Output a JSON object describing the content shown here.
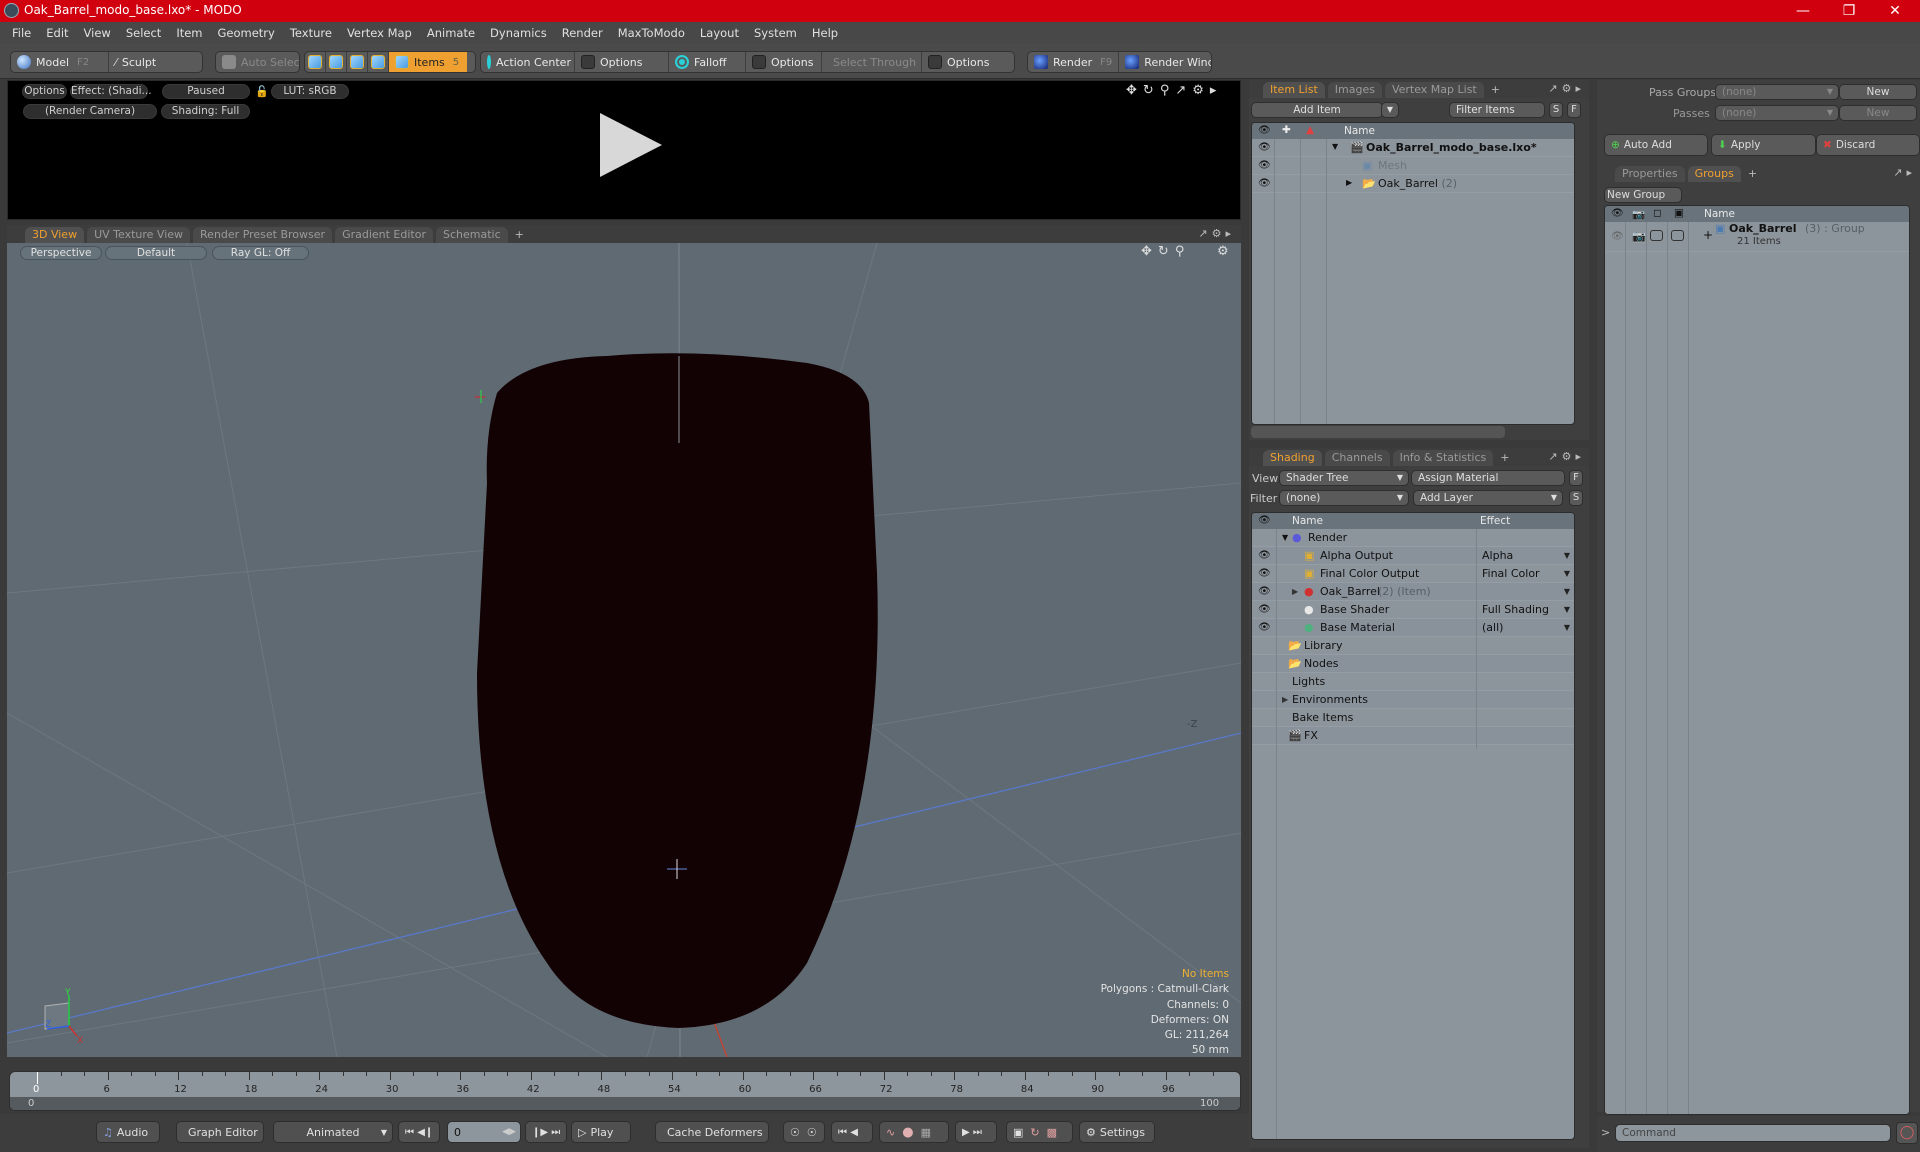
{
  "window": {
    "title": "Oak_Barrel_modo_base.lxo* - MODO",
    "controls": [
      "minimize",
      "restore",
      "close"
    ]
  },
  "menu": [
    "File",
    "Edit",
    "View",
    "Select",
    "Item",
    "Geometry",
    "Texture",
    "Vertex Map",
    "Animate",
    "Dynamics",
    "Render",
    "MaxToModo",
    "Layout",
    "System",
    "Help"
  ],
  "toolbar": {
    "model": "Model",
    "model_key": "F2",
    "sculpt": "Sculpt",
    "auto_select": "Auto Select",
    "items": "Items",
    "items_key": "5",
    "action_center": "Action Center",
    "options1": "Options",
    "falloff": "Falloff",
    "options2": "Options",
    "select_through": "Select Through",
    "options3": "Options",
    "render": "Render",
    "render_key": "F9",
    "render_window": "Render Window",
    "accent": "#f0a030"
  },
  "render_preview": {
    "options": "Options",
    "effect": "Effect: (Shadi...",
    "status": "Paused",
    "lut": "LUT: sRGB",
    "camera": "(Render Camera)",
    "shading": "Shading: Full"
  },
  "viewport_tabs": [
    "3D View",
    "UV Texture View",
    "Render Preset Browser",
    "Gradient Editor",
    "Schematic",
    "+"
  ],
  "viewport": {
    "projection": "Perspective",
    "style": "Default",
    "raygl": "Ray GL: Off",
    "axis_label": "-Z",
    "stats": {
      "selection": "No Items",
      "polygons": "Polygons : Catmull-Clark",
      "channels": "Channels: 0",
      "deformers": "Deformers: ON",
      "gl": "GL: 211,264",
      "focal": "50 mm"
    }
  },
  "timeline": {
    "ticks": [
      "0",
      "6",
      "12",
      "18",
      "24",
      "30",
      "36",
      "42",
      "48",
      "54",
      "60",
      "66",
      "72",
      "78",
      "84",
      "90",
      "96"
    ],
    "range_start": "0",
    "range_end": "100",
    "current_frame": "0"
  },
  "bottombar": {
    "audio": "Audio",
    "graph_editor": "Graph Editor",
    "mode": "Animated",
    "frame": "0",
    "play": "Play",
    "cache_deformers": "Cache Deformers",
    "settings": "Settings"
  },
  "item_list": {
    "tabs": [
      "Item List",
      "Images",
      "Vertex Map List",
      "+"
    ],
    "add_item": "Add Item",
    "filter_placeholder": "Filter Items",
    "s": "S",
    "f": "F",
    "col_name": "Name",
    "rows": [
      {
        "name": "Oak_Barrel_modo_base.lxo*",
        "type": "scene"
      },
      {
        "name": "Mesh",
        "type": "mesh"
      },
      {
        "name": "Oak_Barrel",
        "count": "(2)",
        "type": "group"
      }
    ]
  },
  "shading": {
    "tabs": [
      "Shading",
      "Channels",
      "Info & Statistics",
      "+"
    ],
    "view_label": "View",
    "view_value": "Shader Tree",
    "assign_material": "Assign Material",
    "f": "F",
    "filter_label": "Filter",
    "filter_value": "(none)",
    "add_layer": "Add Layer",
    "s": "S",
    "col_name": "Name",
    "col_effect": "Effect",
    "rows": [
      {
        "name": "Render",
        "effect": ""
      },
      {
        "name": "Alpha Output",
        "effect": "Alpha"
      },
      {
        "name": "Final Color Output",
        "effect": "Final Color"
      },
      {
        "name": "Oak_Barrel",
        "suffix": "(2) (Item)",
        "effect": ""
      },
      {
        "name": "Base Shader",
        "effect": "Full Shading"
      },
      {
        "name": "Base Material",
        "effect": "(all)"
      },
      {
        "name": "Library",
        "effect": ""
      },
      {
        "name": "Nodes",
        "effect": ""
      },
      {
        "name": "Lights",
        "effect": ""
      },
      {
        "name": "Environments",
        "effect": ""
      },
      {
        "name": "Bake Items",
        "effect": ""
      },
      {
        "name": "FX",
        "effect": ""
      }
    ]
  },
  "passes": {
    "pass_groups_label": "Pass Groups",
    "pass_groups_value": "(none)",
    "passes_label": "Passes",
    "passes_value": "(none)",
    "new1": "New",
    "new2": "New",
    "auto_add": "Auto Add",
    "apply": "Apply",
    "discard": "Discard"
  },
  "groups": {
    "tabs": [
      "Properties",
      "Groups",
      "+"
    ],
    "new_group": "New Group",
    "col_name": "Name",
    "rows": [
      {
        "name": "Oak_Barrel",
        "count": "(3)",
        "type": ": Group",
        "sub": "21 Items"
      }
    ]
  },
  "command": {
    "prompt": ">",
    "placeholder": "Command"
  }
}
